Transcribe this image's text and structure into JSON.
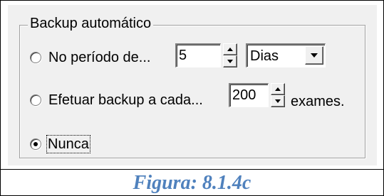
{
  "group": {
    "title": "Backup automático"
  },
  "options": {
    "period": {
      "label": "No período de...",
      "value": "5",
      "unit": "Dias",
      "selected": false
    },
    "exams": {
      "label": "Efetuar backup a cada...",
      "value": "200",
      "suffix": "exames.",
      "selected": false
    },
    "never": {
      "label": "Nunca",
      "selected": true
    }
  },
  "caption": "Figura: 8.1.4c",
  "colors": {
    "dialog_bg": "#f0f0f0",
    "caption": "#4f81bd"
  },
  "icons": {
    "spin_up": "triangle-up",
    "spin_down": "triangle-down",
    "dropdown": "triangle-down"
  }
}
